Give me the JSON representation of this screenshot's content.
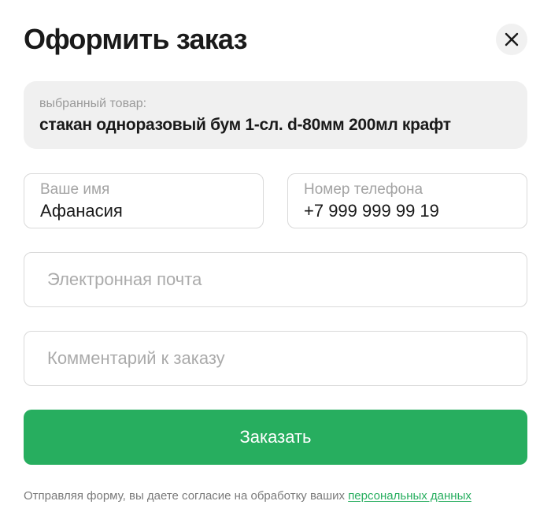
{
  "dialog": {
    "title": "Оформить заказ",
    "close_icon": "close-icon"
  },
  "product": {
    "caption": "выбранный товар:",
    "name": "стакан одноразовый бум 1-сл. d-80мм 200мл крафт"
  },
  "form": {
    "name": {
      "label": "Ваше имя",
      "value": "Афанасия"
    },
    "phone": {
      "label": "Номер телефона",
      "value": "+7 999 999 99 19"
    },
    "email": {
      "placeholder": "Электронная почта"
    },
    "comment": {
      "placeholder": "Комментарий к заказу"
    },
    "submit_label": "Заказать"
  },
  "consent": {
    "text": "Отправляя форму, вы даете согласие на обработку ваших ",
    "link_text": "персональных данных"
  },
  "colors": {
    "accent": "#27ae5f",
    "product_bg": "#f0f0f0",
    "border": "#d9d9d9",
    "placeholder": "#ababab"
  }
}
